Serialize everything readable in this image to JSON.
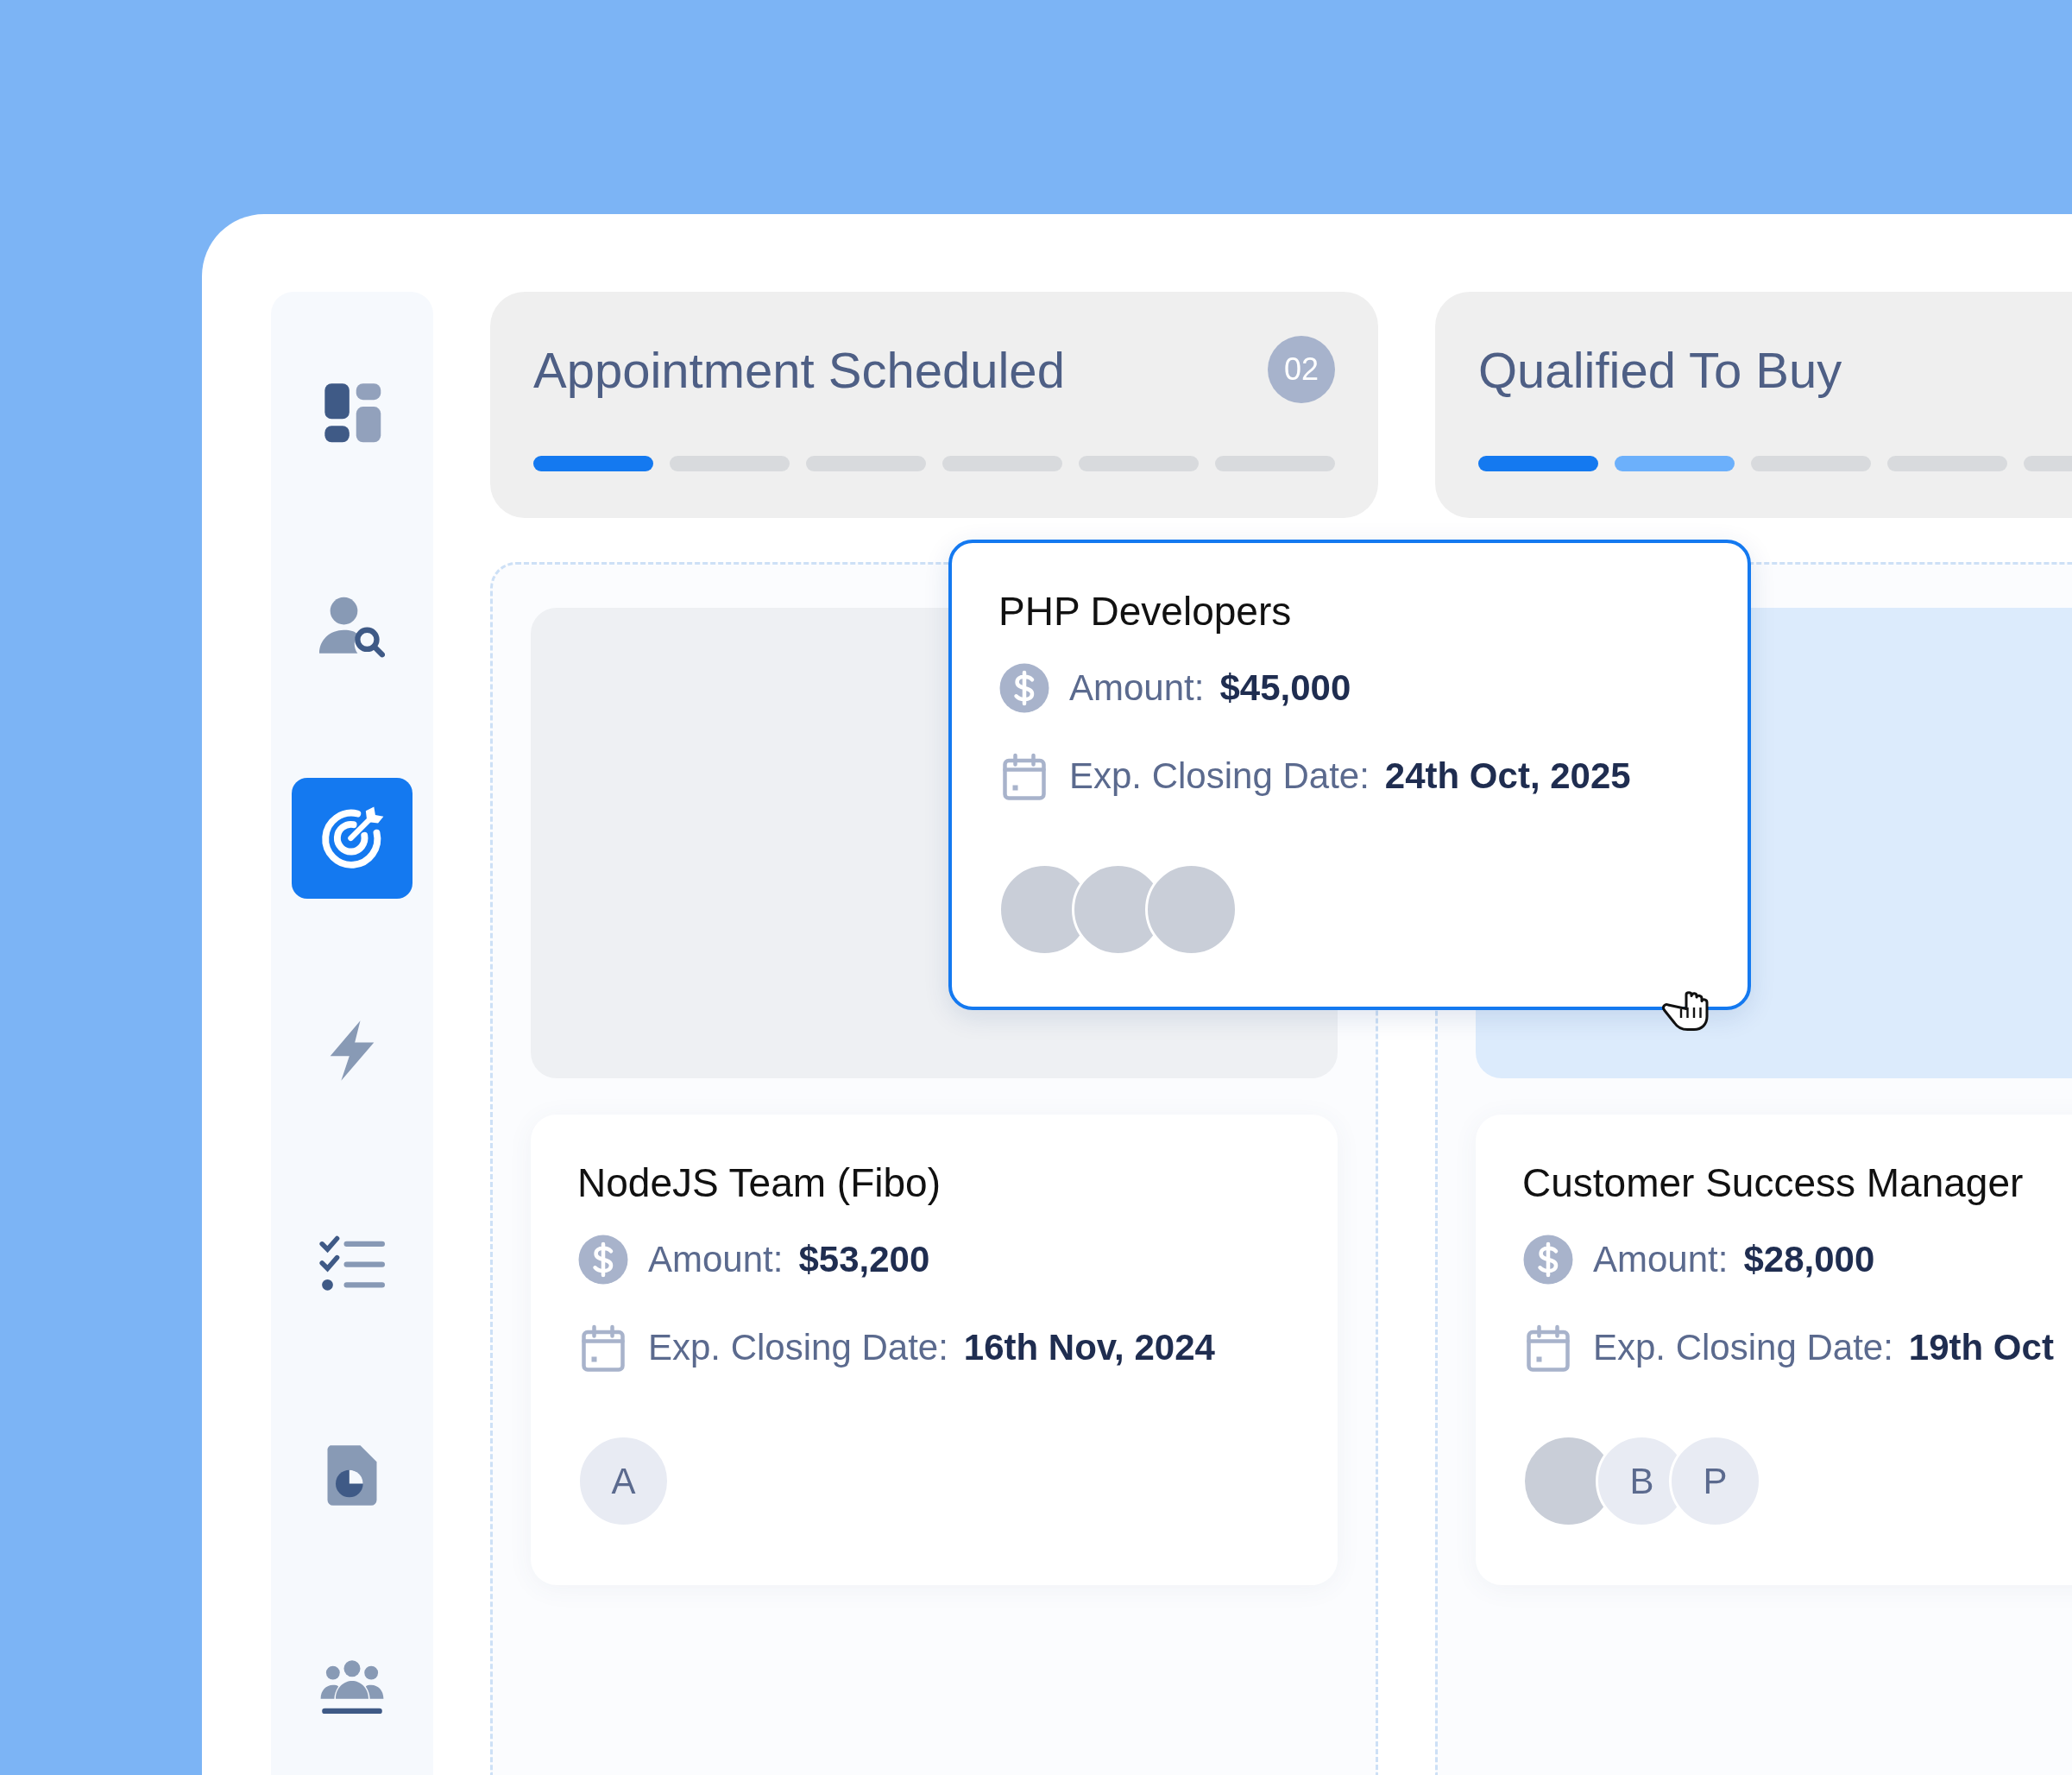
{
  "sidebar": {
    "items": [
      {
        "kind": "dashboard",
        "selected": false
      },
      {
        "kind": "user-search",
        "selected": false
      },
      {
        "kind": "target",
        "selected": true
      },
      {
        "kind": "bolt",
        "selected": false
      },
      {
        "kind": "checklist",
        "selected": false
      },
      {
        "kind": "report",
        "selected": false
      },
      {
        "kind": "team",
        "selected": false
      }
    ]
  },
  "columns": [
    {
      "title": "Appointment Scheduled",
      "count": "02",
      "segments": [
        {
          "completed": true,
          "current": false
        },
        {
          "completed": false,
          "current": false
        },
        {
          "completed": false,
          "current": false
        },
        {
          "completed": false,
          "current": false
        },
        {
          "completed": false,
          "current": false
        },
        {
          "completed": false,
          "current": false
        }
      ],
      "cards": [
        {
          "kind": "slot",
          "highlighted": false
        },
        {
          "kind": "deal",
          "title": "NodeJS Team (Fibo)",
          "amount_label": "Amount:",
          "amount": "$53,200",
          "date_label": "Exp. Closing Date:",
          "date": "16th Nov, 2024",
          "assignees": [
            {
              "kind": "initial",
              "initial": "A"
            }
          ]
        }
      ]
    },
    {
      "title": "Qualified To Buy",
      "segments": [
        {
          "completed": true,
          "current": false
        },
        {
          "completed": false,
          "current": true
        },
        {
          "completed": false,
          "current": false
        },
        {
          "completed": false,
          "current": false
        },
        {
          "completed": false,
          "current": false
        }
      ],
      "cards": [
        {
          "kind": "slot",
          "highlighted": true
        },
        {
          "kind": "deal",
          "title": "Customer Success Manager",
          "amount_label": "Amount:",
          "amount": "$28,000",
          "date_label": "Exp. Closing Date:",
          "date": "19th Oct",
          "assignees": [
            {
              "kind": "photo"
            },
            {
              "kind": "initial",
              "initial": "B"
            },
            {
              "kind": "initial",
              "initial": "P"
            }
          ]
        }
      ]
    }
  ],
  "dragging_card": {
    "title": "PHP Developers",
    "amount_label": "Amount:",
    "amount": "$45,000",
    "date_label": "Exp. Closing Date:",
    "date": "24th Oct, 2025",
    "assignees": [
      {
        "kind": "photo"
      },
      {
        "kind": "photo"
      },
      {
        "kind": "photo"
      }
    ]
  }
}
